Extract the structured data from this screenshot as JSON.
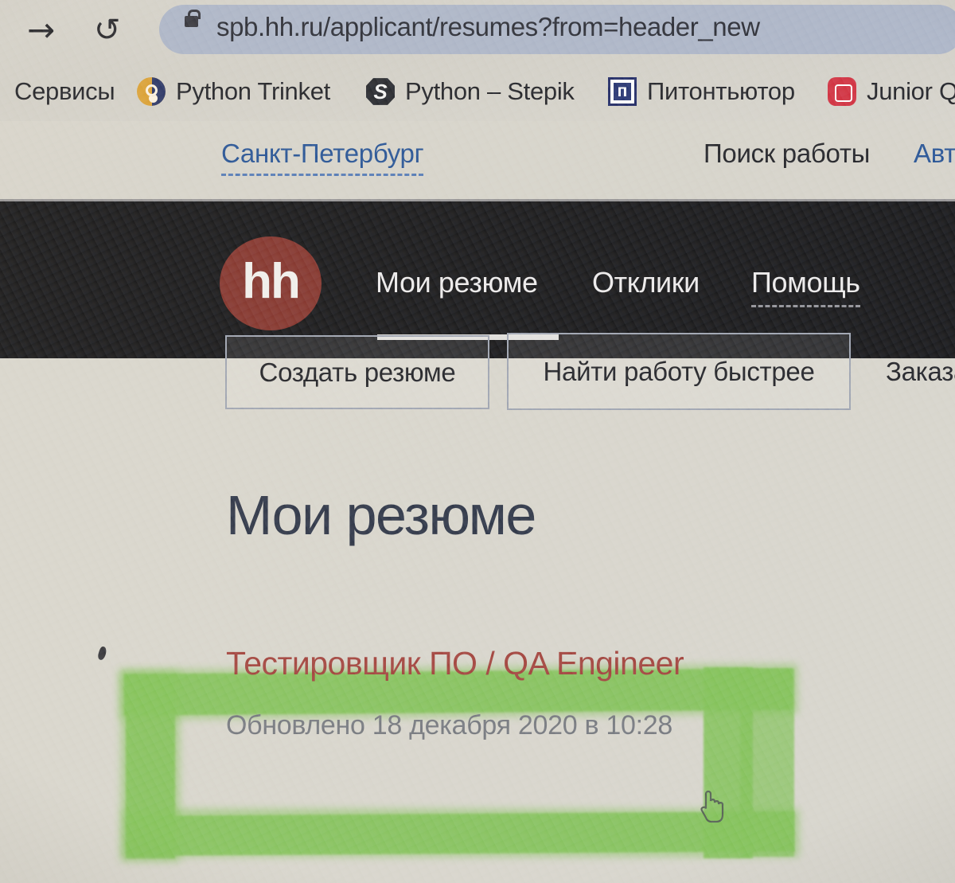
{
  "browser": {
    "forward_icon": "forward-arrow-icon",
    "reload_icon": "reload-icon",
    "lock_icon": "lock-icon",
    "url": "spb.hh.ru/applicant/resumes?from=header_new",
    "bookmarks": [
      {
        "label": "Сервисы",
        "icon": "apps-icon"
      },
      {
        "label": "Python Trinket",
        "icon": "trinket-favicon"
      },
      {
        "label": "Python – Stepik",
        "icon": "stepik-favicon"
      },
      {
        "label": "Питонтьютор",
        "icon": "pythontutor-favicon"
      },
      {
        "label": "Junior Q",
        "icon": "junior-favicon"
      }
    ]
  },
  "topbar": {
    "city": "Санкт-Петербург",
    "search_jobs": "Поиск работы",
    "auth": "Авт"
  },
  "nav": {
    "logo_text": "hh",
    "items": [
      {
        "label": "Мои резюме",
        "active": true
      },
      {
        "label": "Отклики",
        "active": false
      },
      {
        "label": "Помощь",
        "active": false
      }
    ]
  },
  "actions": {
    "create_resume": "Создать резюме",
    "find_job_faster": "Найти работу быстрее",
    "order_service": "Заказа"
  },
  "main": {
    "heading": "Мои резюме",
    "resume": {
      "title": "Тестировщик ПО / QA Engineer",
      "updated": "Обновлено 18 декабря 2020 в 10:28"
    }
  },
  "annotation": {
    "type": "green-highlighter-rectangle",
    "color": "#7dbf50"
  },
  "colors": {
    "brand_red": "#7d2a22",
    "nav_bg": "#0b0b0d",
    "link_blue": "#1b4a8f",
    "resume_link": "#9e3a33",
    "page_bg": "#d6d3c9",
    "omnibox_bg": "#a8b1c4",
    "highlighter_green": "#7dbf50"
  }
}
